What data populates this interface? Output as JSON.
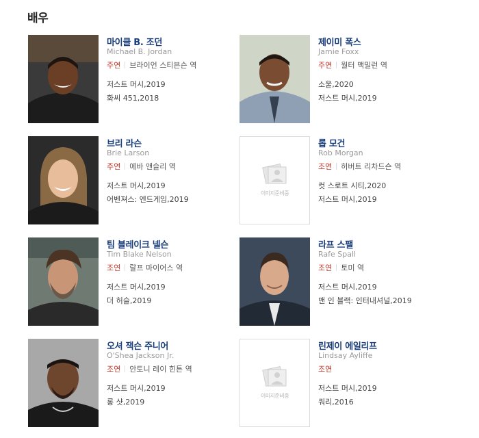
{
  "section": {
    "title": "배우"
  },
  "actors": [
    {
      "name": "마이클 B. 조던",
      "english_name": "Michael B. Jordan",
      "role_type": "주연",
      "role": "브라이언 스티븐슨 역",
      "works": [
        "저스트 머시,2019",
        "화씨 451,2018"
      ],
      "photo": "available"
    },
    {
      "name": "제이미 폭스",
      "english_name": "Jamie Foxx",
      "role_type": "주연",
      "role": "월터 맥밀런 역",
      "works": [
        "소울,2020",
        "저스트 머시,2019"
      ],
      "photo": "available"
    },
    {
      "name": "브리 라슨",
      "english_name": "Brie Larson",
      "role_type": "주연",
      "role": "에바 앤슬리 역",
      "works": [
        "저스트 머시,2019",
        "어벤져스: 엔드게임,2019"
      ],
      "photo": "available"
    },
    {
      "name": "롭 모건",
      "english_name": "Rob Morgan",
      "role_type": "조연",
      "role": "허버트 리차드슨 역",
      "works": [
        "컷 스로트 시티,2020",
        "저스트 머시,2019"
      ],
      "photo": "placeholder"
    },
    {
      "name": "팀 블레이크 넬슨",
      "english_name": "Tim Blake Nelson",
      "role_type": "조연",
      "role": "랄프 마이어스 역",
      "works": [
        "저스트 머시,2019",
        "더 허슬,2019"
      ],
      "photo": "available"
    },
    {
      "name": "라프 스팰",
      "english_name": "Rafe Spall",
      "role_type": "조연",
      "role": "토미 역",
      "works": [
        "저스트 머시,2019",
        "맨 인 블랙: 인터내셔널,2019"
      ],
      "photo": "available"
    },
    {
      "name": "오셔 잭슨 주니어",
      "english_name": "O'Shea Jackson Jr.",
      "role_type": "조연",
      "role": "안토니 레이 힌튼 역",
      "works": [
        "저스트 머시,2019",
        "롱 샷,2019"
      ],
      "photo": "available"
    },
    {
      "name": "린제이 에일리프",
      "english_name": "Lindsay Ayliffe",
      "role_type": "조연",
      "role": "",
      "works": [
        "저스트 머시,2019",
        "쿼리,2016"
      ],
      "photo": "placeholder"
    }
  ],
  "placeholder_text": "이미지준비중",
  "colors": {
    "name": "#1a3e7a",
    "role_type": "#c0392b",
    "english_name": "#999999"
  }
}
